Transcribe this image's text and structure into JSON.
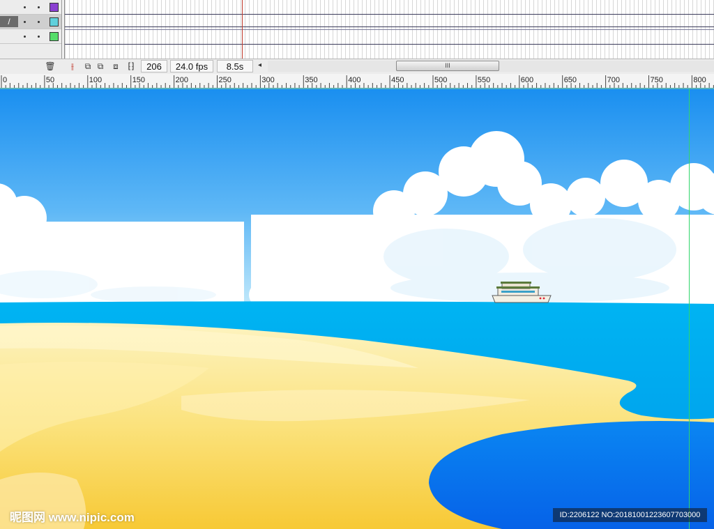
{
  "timeline": {
    "layers": [
      {
        "color": "#8a3fd1"
      },
      {
        "color": "#5fd0dc",
        "active": true,
        "pencil": "/"
      },
      {
        "color": "#55dd6a"
      }
    ],
    "toolbar": {
      "current_frame": "206",
      "frame_rate": "24.0 fps",
      "elapsed_time": "8.5s",
      "scroll_left_glyph": "◂",
      "scroll_thumb_grip": "III"
    }
  },
  "ruler": {
    "labels": [
      "0",
      "50",
      "100",
      "150",
      "200",
      "250",
      "300",
      "350",
      "400",
      "450",
      "500",
      "550",
      "600",
      "650",
      "700",
      "750",
      "800"
    ]
  },
  "stage": {
    "colors": {
      "sky_top": "#1a8ff0",
      "sky_bottom": "#b8e6fb",
      "cloud": "#ffffff",
      "sea": "#00aef0",
      "sand_light": "#fdf1b8",
      "sand_dark": "#f7cd3e",
      "lagoon": "#0a7ff0",
      "guide": "#2fd66a"
    }
  },
  "watermark": {
    "logo_text": "昵图网 www.nipic.com",
    "id_text": "ID:2206122 NO:20181001223607703000"
  }
}
